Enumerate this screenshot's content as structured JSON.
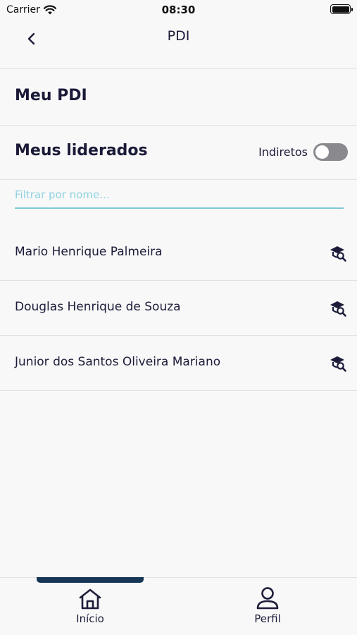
{
  "status_bar": {
    "carrier": "Carrier",
    "time": "08:30"
  },
  "nav": {
    "title": "PDI"
  },
  "meu_pdi": {
    "title": "Meu PDI"
  },
  "liderados": {
    "title": "Meus liderados",
    "toggle_label": "Indiretos",
    "toggle_on": false
  },
  "filter": {
    "placeholder": "Filtrar por nome...",
    "value": ""
  },
  "people": [
    {
      "name": "Mario Henrique Palmeira"
    },
    {
      "name": "Douglas Henrique de Souza"
    },
    {
      "name": "Junior dos Santos Oliveira Mariano"
    }
  ],
  "tabs": [
    {
      "label": "Início",
      "icon": "home-icon",
      "active": true
    },
    {
      "label": "Perfil",
      "icon": "user-icon",
      "active": false
    }
  ],
  "colors": {
    "accent": "#173554",
    "filter_underline": "#7fc9d8",
    "text": "#1c1c3a"
  }
}
